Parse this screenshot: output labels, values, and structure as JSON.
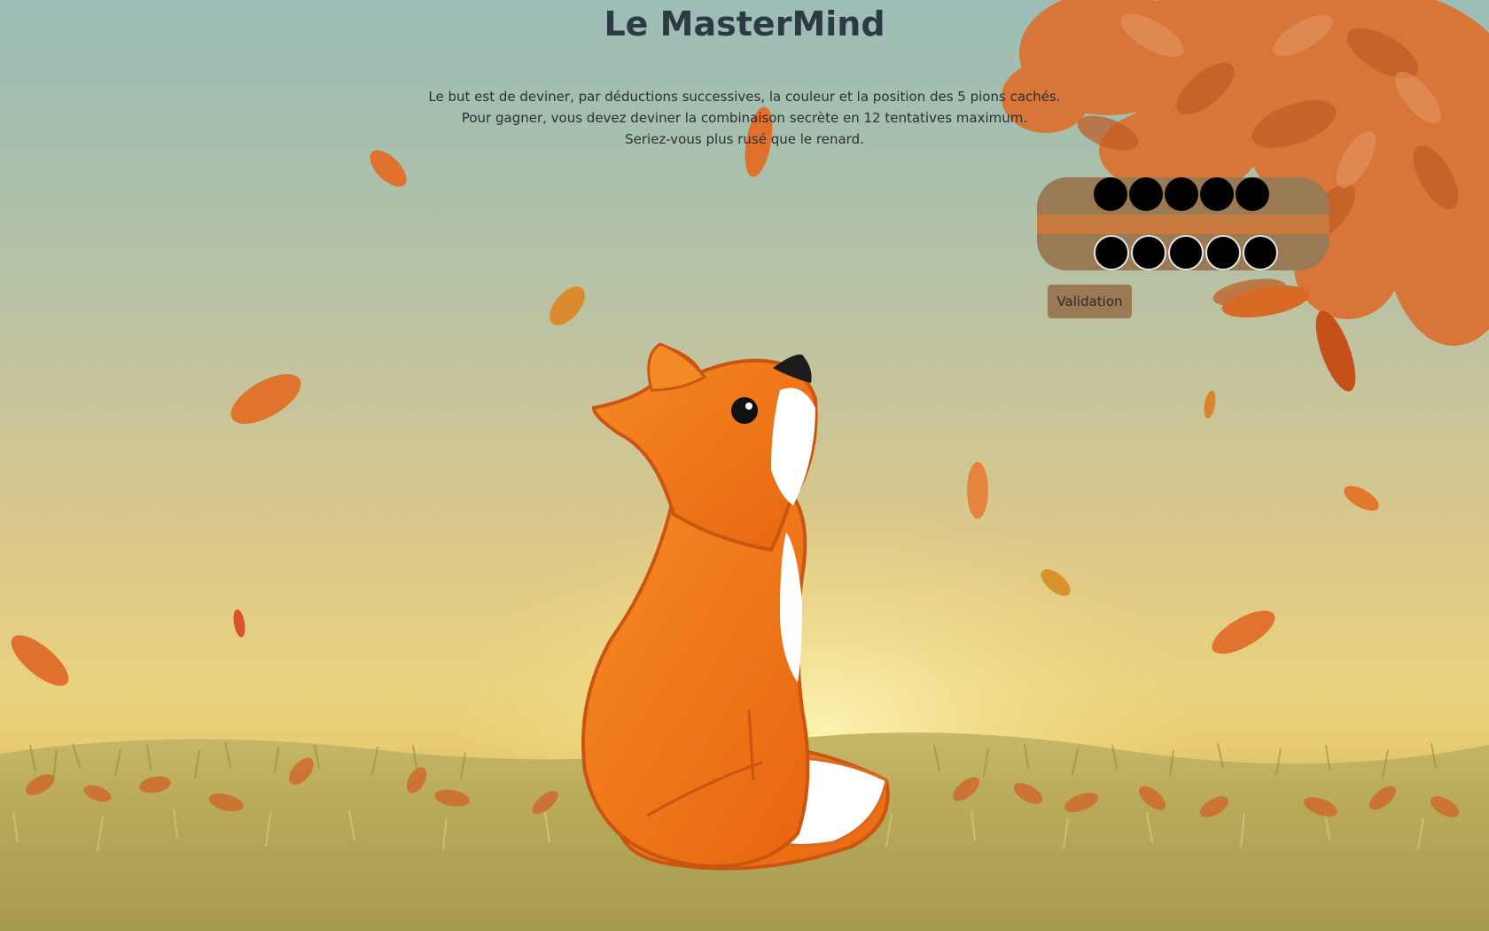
{
  "page": {
    "title": "Le MasterMind",
    "intro_lines": [
      "Le but est de deviner, par déductions successives, la couleur et la position des 5 pions cachés.",
      "Pour gagner, vous devez deviner la combinaison secrète en 12 tentatives maximum.",
      "Seriez-vous plus rusé que le renard."
    ]
  },
  "board": {
    "hidden_pegs": [
      "black",
      "black",
      "black",
      "black",
      "black"
    ],
    "guess_pegs": [
      "black",
      "black",
      "black",
      "black",
      "black"
    ]
  },
  "actions": {
    "validate_label": "Validation"
  },
  "colors": {
    "board": "#9a7a55",
    "board_stripe": "#c87a3c",
    "peg": "#000000",
    "fox": "#f07a1a",
    "leaf": "#e0702e"
  },
  "illustration": {
    "subject": "fox-sitting-looking-up",
    "scenery": [
      "autumn-tree",
      "falling-leaves",
      "grass-meadow"
    ]
  }
}
